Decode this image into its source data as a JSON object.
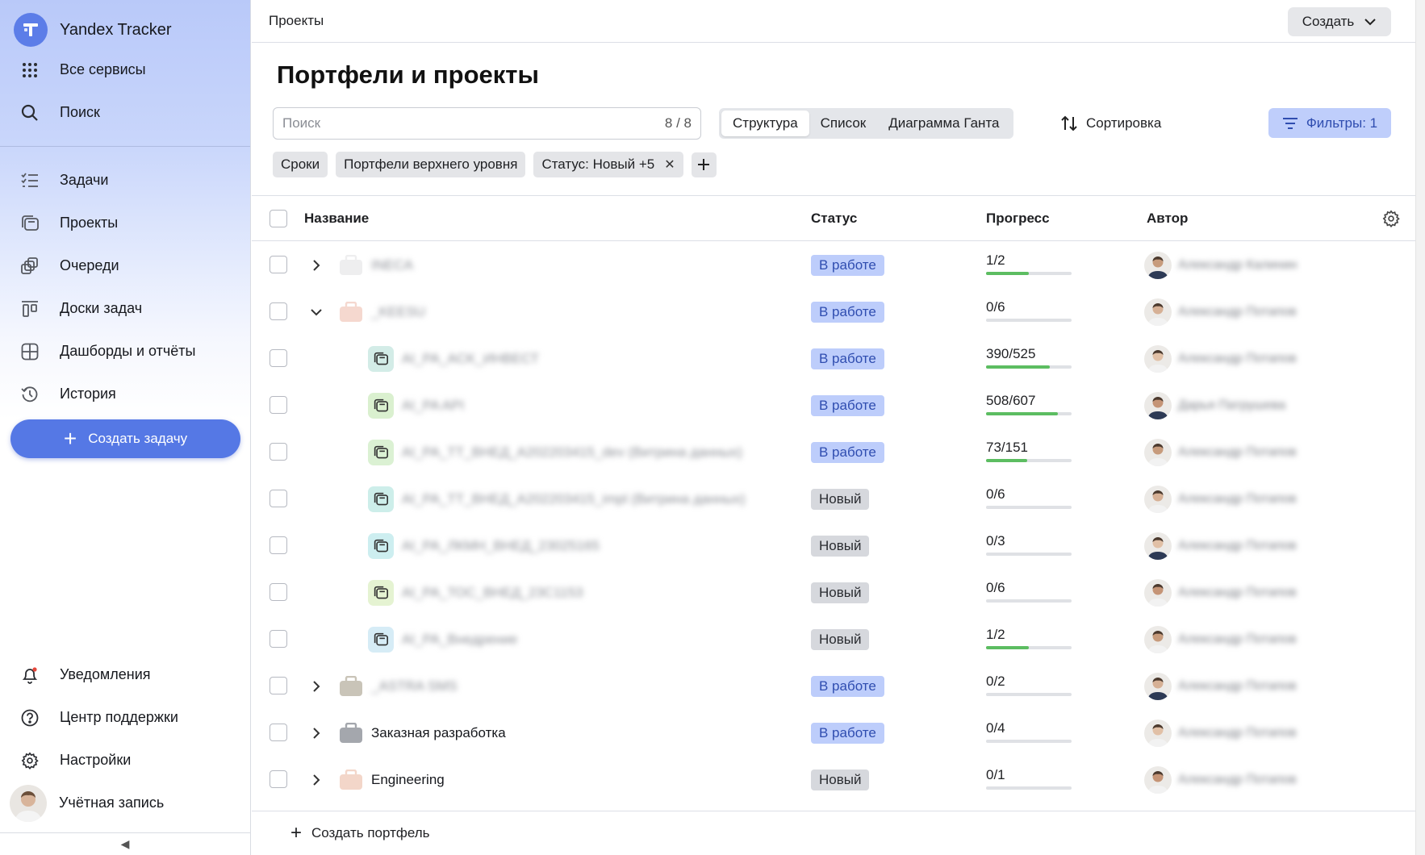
{
  "app": {
    "name": "Yandex Tracker"
  },
  "sidebar": {
    "top": [
      {
        "label": "Все сервисы",
        "icon": "grid-icon"
      },
      {
        "label": "Поиск",
        "icon": "search-icon"
      }
    ],
    "nav": [
      {
        "label": "Задачи",
        "icon": "tasks-icon"
      },
      {
        "label": "Проекты",
        "icon": "projects-icon"
      },
      {
        "label": "Очереди",
        "icon": "queues-icon"
      },
      {
        "label": "Доски задач",
        "icon": "boards-icon"
      },
      {
        "label": "Дашборды и отчёты",
        "icon": "dashboards-icon"
      },
      {
        "label": "История",
        "icon": "history-icon"
      }
    ],
    "create_task": "Создать задачу",
    "bottom": [
      {
        "label": "Уведомления",
        "icon": "bell-icon"
      },
      {
        "label": "Центр поддержки",
        "icon": "help-icon"
      },
      {
        "label": "Настройки",
        "icon": "gear-icon"
      },
      {
        "label": "Учётная запись",
        "icon": "avatar"
      }
    ],
    "collapse": "◀"
  },
  "header": {
    "breadcrumb": "Проекты",
    "create": "Создать"
  },
  "page": {
    "title": "Портфели и проекты"
  },
  "search": {
    "placeholder": "Поиск",
    "count": "8 / 8"
  },
  "views": [
    "Структура",
    "Список",
    "Диаграмма Ганта"
  ],
  "sort": "Сортировка",
  "filters": "Фильтры: 1",
  "chips": [
    "Сроки",
    "Портфели верхнего уровня",
    "Статус: Новый +5"
  ],
  "columns": {
    "name": "Название",
    "status": "Статус",
    "progress": "Прогресс",
    "author": "Автор"
  },
  "colors": {
    "accent": "#5578e5",
    "status_work_bg": "#bdcdfb",
    "status_new_bg": "#d6d8dd",
    "progress": "#5cbd61"
  },
  "rows": [
    {
      "type": "portfolio",
      "expanded": false,
      "level": 0,
      "name": "INECA",
      "blurred": true,
      "status": "В работе",
      "status_kind": "work",
      "progress": "1/2",
      "progress_value": 0.5,
      "author": "Александр Калинин",
      "icon_color": "#eeeeef"
    },
    {
      "type": "portfolio",
      "expanded": true,
      "level": 0,
      "name": "_KEESU",
      "blurred": true,
      "status": "В работе",
      "status_kind": "work",
      "progress": "0/6",
      "progress_value": 0,
      "author": "Александр Потапов",
      "icon_color": "#f5d8cf"
    },
    {
      "type": "project",
      "level": 1,
      "name": "AI_PA_ACK_ИНВЕСТ",
      "blurred": true,
      "status": "В работе",
      "status_kind": "work",
      "progress": "390/525",
      "progress_value": 0.743,
      "author": "Александр Потапов",
      "icon_color": "#d3ece7"
    },
    {
      "type": "project",
      "level": 1,
      "name": "AI_PA API",
      "blurred": true,
      "status": "В работе",
      "status_kind": "work",
      "progress": "508/607",
      "progress_value": 0.837,
      "author": "Дарья Патрушева",
      "icon_color": "#daf0cf"
    },
    {
      "type": "project",
      "level": 1,
      "name": "AI_PA_ТТ_ВНЕД_А202203415_dev (Витрина данных)",
      "blurred": true,
      "status": "В работе",
      "status_kind": "work",
      "progress": "73/151",
      "progress_value": 0.483,
      "author": "Александр Потапов",
      "icon_color": "#dbf1d3"
    },
    {
      "type": "project",
      "level": 1,
      "name": "AI_PA_ТТ_ВНЕД_А202203415_impl (Витрина данных)",
      "blurred": true,
      "status": "Новый",
      "status_kind": "new",
      "progress": "0/6",
      "progress_value": 0,
      "author": "Александр Потапов",
      "icon_color": "#cdeeea"
    },
    {
      "type": "project",
      "level": 1,
      "name": "AI_PA_ЛКМН_ВНЕД_23025165",
      "blurred": true,
      "status": "Новый",
      "status_kind": "new",
      "progress": "0/3",
      "progress_value": 0,
      "author": "Александр Потапов",
      "icon_color": "#cdeef0"
    },
    {
      "type": "project",
      "level": 1,
      "name": "AI_PA_ТОС_ВНЕД_23С1153",
      "blurred": true,
      "status": "Новый",
      "status_kind": "new",
      "progress": "0/6",
      "progress_value": 0,
      "author": "Александр Потапов",
      "icon_color": "#e5f3d2"
    },
    {
      "type": "project",
      "level": 1,
      "name": "AI_PA_Внедрение",
      "blurred": true,
      "status": "Новый",
      "status_kind": "new",
      "progress": "1/2",
      "progress_value": 0.5,
      "author": "Александр Потапов",
      "icon_color": "#d6ecf6"
    },
    {
      "type": "portfolio",
      "expanded": false,
      "level": 0,
      "name": "_ASTRA SMS",
      "blurred": true,
      "status": "В работе",
      "status_kind": "work",
      "progress": "0/2",
      "progress_value": 0,
      "author": "Александр Потапов",
      "icon_color": "#c9c4b8"
    },
    {
      "type": "portfolio",
      "expanded": false,
      "level": 0,
      "name": "Заказная разработка",
      "blurred": false,
      "status": "В работе",
      "status_kind": "work",
      "progress": "0/4",
      "progress_value": 0,
      "author": "Александр Потапов",
      "icon_color": "#a4a7ad"
    },
    {
      "type": "portfolio",
      "expanded": false,
      "level": 0,
      "name": "Engineering",
      "blurred": false,
      "status": "Новый",
      "status_kind": "new",
      "progress": "0/1",
      "progress_value": 0,
      "author": "Александр Потапов",
      "icon_color": "#f3d6c9"
    }
  ],
  "footer": {
    "create_portfolio": "Создать портфель"
  }
}
